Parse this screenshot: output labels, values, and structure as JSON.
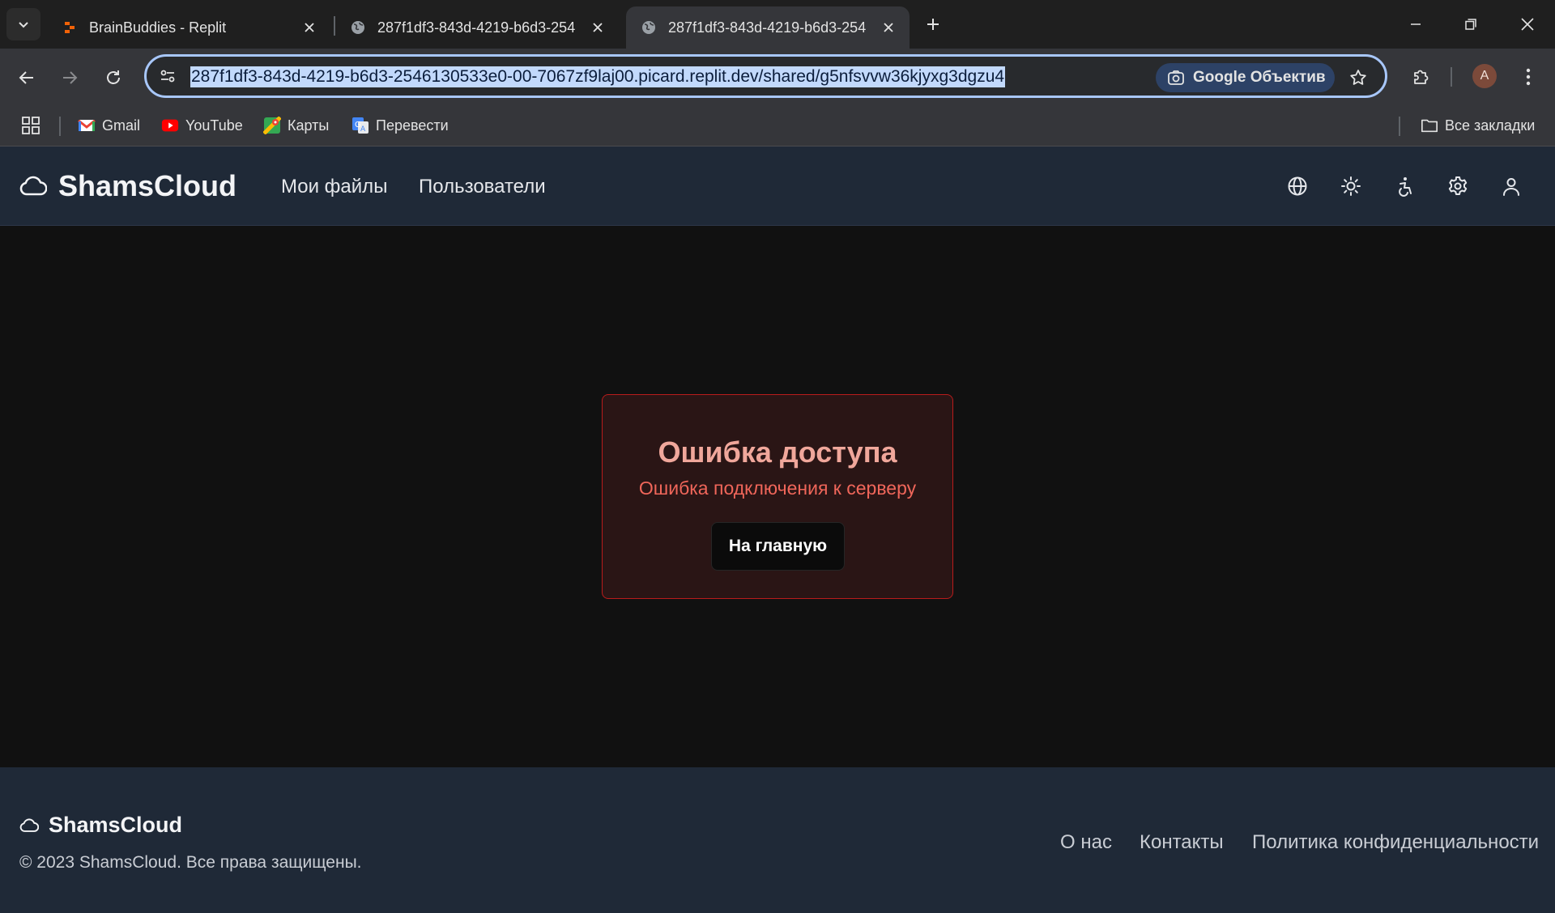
{
  "browser": {
    "tabs": [
      {
        "title": "BrainBuddies - Replit",
        "active": false
      },
      {
        "title": "287f1df3-843d-4219-b6d3-254",
        "active": false
      },
      {
        "title": "287f1df3-843d-4219-b6d3-254",
        "active": true
      }
    ],
    "address_bar": {
      "url": "287f1df3-843d-4219-b6d3-2546130533e0-00-7067zf9laj00.picard.replit.dev/shared/g5nfsvvw36kjyxg3dgzu4",
      "lens_label": "Google Объектив"
    },
    "profile_initial": "A",
    "bookmarks": [
      {
        "label": "Gmail",
        "icon": "gmail-icon"
      },
      {
        "label": "YouTube",
        "icon": "youtube-icon"
      },
      {
        "label": "Карты",
        "icon": "maps-icon"
      },
      {
        "label": "Перевести",
        "icon": "translate-icon"
      }
    ],
    "all_bookmarks_label": "Все закладки"
  },
  "app": {
    "brand": "ShamsCloud",
    "nav": {
      "my_files": "Мои файлы",
      "users": "Пользователи"
    },
    "header_icons": [
      "globe-icon",
      "sun-icon",
      "accessibility-icon",
      "gear-icon",
      "user-icon"
    ]
  },
  "error": {
    "title": "Ошибка доступа",
    "message": "Ошибка подключения к серверу",
    "button_label": "На главную"
  },
  "footer": {
    "brand": "ShamsCloud",
    "copyright": "© 2023 ShamsCloud. Все права защищены.",
    "links": {
      "about": "О нас",
      "contacts": "Контакты",
      "privacy": "Политика конфиденциальности"
    }
  },
  "colors": {
    "header_bg": "#1f2937",
    "page_bg": "#111111",
    "error_border": "#b91c1c",
    "error_title": "#f0a79b",
    "error_message": "#f0665a"
  }
}
